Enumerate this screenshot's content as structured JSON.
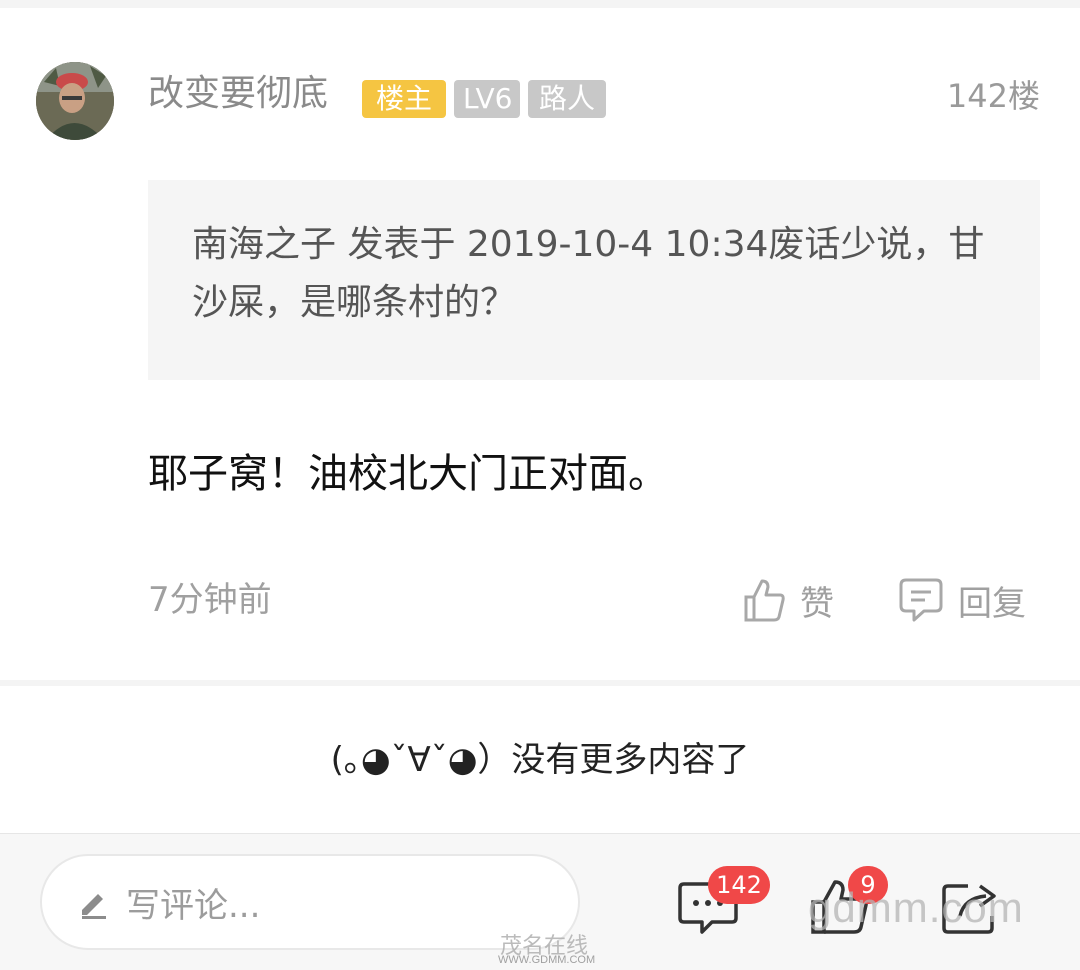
{
  "post": {
    "username": "改变要彻底",
    "badges": {
      "host": "楼主",
      "level": "LV6",
      "role": "路人"
    },
    "floor": "142楼",
    "quote_text": "南海之子 发表于 2019-10-4 10:34废话少说，甘沙屎，是哪条村的？",
    "reply_text": "耶子窝！油校北大门正对面。",
    "time": "7分钟前",
    "like_label": "赞",
    "reply_label": "回复"
  },
  "end_message": "(｡◕ˇ∀ˇ◕）没有更多内容了",
  "bottom_bar": {
    "comment_placeholder": "写评论...",
    "comment_count": "142",
    "like_count": "9"
  },
  "watermark": {
    "brand": "gdmm.com",
    "site_name": "茂名在线",
    "url": "WWW.GDMM.COM"
  },
  "colors": {
    "host_badge": "#f5c542",
    "gray_badge": "#c8c8c8",
    "count_badge": "#f04848",
    "quote_bg": "#f5f5f5"
  }
}
